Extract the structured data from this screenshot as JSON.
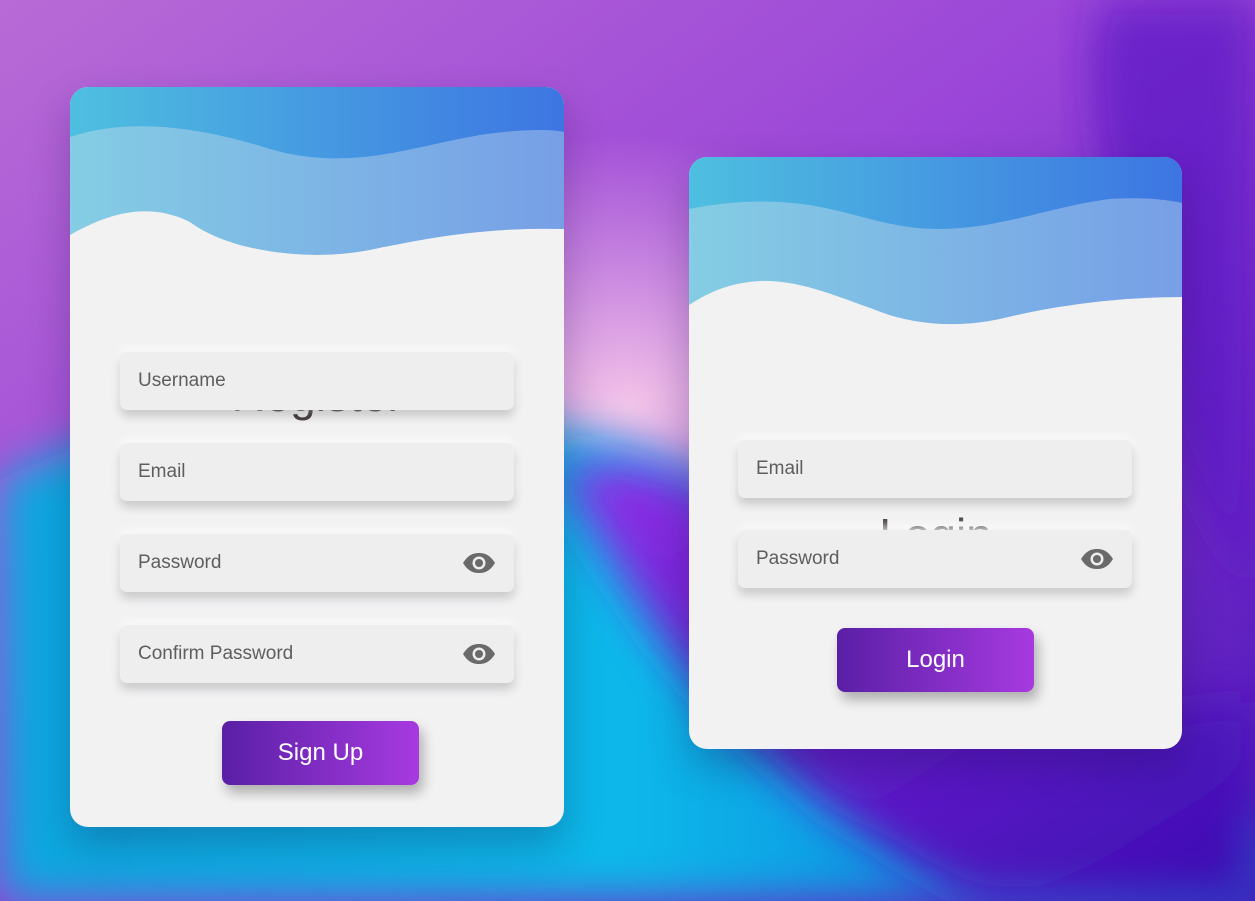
{
  "colors": {
    "card_bg": "#f2f2f3",
    "title_text": "#4a4245",
    "button_gradient_start": "#5a1fa6",
    "button_gradient_end": "#a73ae0",
    "wave_dark_start": "#4ebfe0",
    "wave_dark_end": "#3d75e2",
    "wave_light_start": "#84cde4",
    "wave_light_end": "#779fe6"
  },
  "register": {
    "title": "Register",
    "username": {
      "placeholder": "Username",
      "value": ""
    },
    "email": {
      "placeholder": "Email",
      "value": ""
    },
    "password": {
      "placeholder": "Password",
      "value": "",
      "icon": "eye-icon"
    },
    "confirm_password": {
      "placeholder": "Confirm Password",
      "value": "",
      "icon": "eye-icon"
    },
    "submit_label": "Sign Up"
  },
  "login": {
    "title": "Login",
    "email": {
      "placeholder": "Email",
      "value": ""
    },
    "password": {
      "placeholder": "Password",
      "value": "",
      "icon": "eye-icon"
    },
    "submit_label": "Login"
  }
}
